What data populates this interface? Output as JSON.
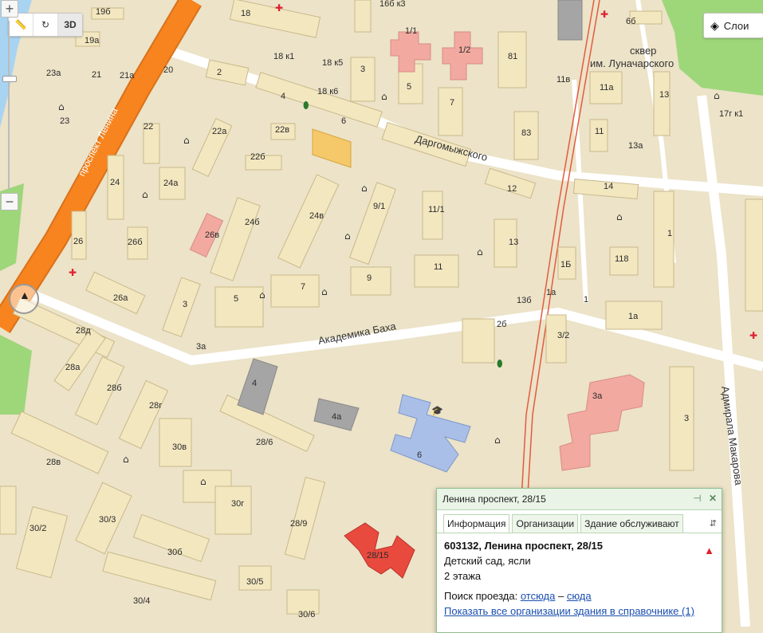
{
  "controls": {
    "ruler_icon": "ruler-icon",
    "rotate_icon": "rotate-icon",
    "mode_3d_label": "3D",
    "zoom_in": "+",
    "zoom_out": "−",
    "layers_label": "Слои"
  },
  "streets": {
    "lenina": "проспект Ленина",
    "dargomyzhskogo": "Даргомыжского",
    "akademika_bakha": "Академика Баха",
    "admirala_makarova": "Адмирала Макарова",
    "park_line1": "сквер",
    "park_line2": "им. Луначарского"
  },
  "buildings": [
    "19б",
    "18",
    "16б к3",
    "6б",
    "1/1",
    "1/2",
    "81",
    "19а",
    "18 к1",
    "18 к5",
    "3",
    "23а",
    "21",
    "21а",
    "20",
    "2",
    "5",
    "11в",
    "11а",
    "18 к6",
    "7",
    "13",
    "4",
    "23",
    "22",
    "22а",
    "6",
    "22в",
    "83",
    "11",
    "17г к1",
    "13а",
    "22б",
    "24",
    "24а",
    "12",
    "14",
    "9/1",
    "11/1",
    "24в",
    "26",
    "26б",
    "24б",
    "26в",
    "13",
    "1",
    "1Б",
    "118",
    "11",
    "9",
    "7",
    "5",
    "26а",
    "3",
    "1а",
    "13б",
    "1",
    "2б",
    "3/2",
    "1а",
    "28д",
    "3а",
    "28а",
    "28б",
    "4",
    "28г",
    "4а",
    "3а",
    "6",
    "3",
    "30в",
    "28/6",
    "28в",
    "30г",
    "28/9",
    "30/2",
    "30/3",
    "30б",
    "28/15",
    "30/5",
    "30/4",
    "30/6"
  ],
  "popup": {
    "title": "Ленина проспект, 28/15",
    "tabs": [
      "Информация",
      "Организации",
      "Здание обслуживают"
    ],
    "address": "603132, Ленина проспект, 28/15",
    "type": "Детский сад, ясли",
    "floors": "2 этажа",
    "route_prefix": "Поиск проезда:",
    "route_from": "отсюда",
    "route_dash": "–",
    "route_to": "сюда",
    "all_orgs_link": "Показать все организации здания в справочнике (1)"
  },
  "colors": {
    "map_bg": "#ece3c8",
    "main_road": "#f7841f",
    "park": "#9ed67a",
    "water": "#a8d4f2",
    "selected_building": "#e84a3d",
    "school": "#a9bfe8",
    "medical": "#f2a9a0",
    "garage": "#a5a5a5",
    "highlight_building": "#f5c86a",
    "tram": "#e35b3f"
  }
}
